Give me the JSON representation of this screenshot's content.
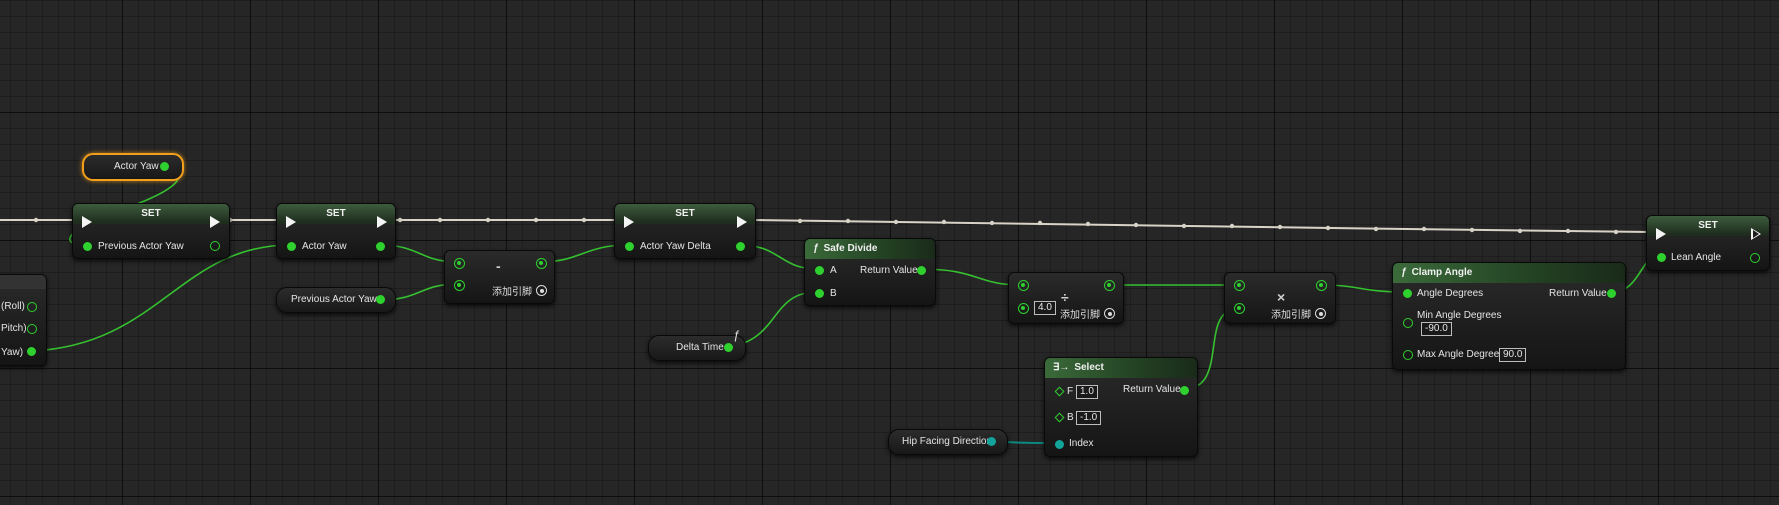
{
  "graph": {
    "add_pin_label": "添加引脚",
    "exec_wire_color": "#d8d3c6",
    "float_wire_color": "#35c030",
    "byte_wire_color": "#0b8a7f",
    "selection_color": "#f29f1b"
  },
  "actor_yaw_getter": {
    "label": "Actor Yaw"
  },
  "left_partial_node": {
    "pins": [
      "(Roll)",
      "Pitch)",
      "Yaw)"
    ]
  },
  "set_previous": {
    "title": "SET",
    "pin_label": "Previous Actor Yaw"
  },
  "set_actor_yaw": {
    "title": "SET",
    "pin_label": "Actor Yaw"
  },
  "previous_actor_yaw_getter": {
    "label": "Previous Actor Yaw"
  },
  "subtract_node": {
    "operator": "-"
  },
  "set_yaw_delta": {
    "title": "SET",
    "pin_label": "Actor Yaw Delta"
  },
  "delta_time_getter": {
    "label": "Delta Time"
  },
  "safe_divide": {
    "title": "Safe Divide",
    "pin_a": "A",
    "pin_b": "B",
    "return_label": "Return Value"
  },
  "divide_node": {
    "operator": "÷",
    "value": "4.0"
  },
  "multiply_node": {
    "operator": "×"
  },
  "select_node": {
    "title": "Select",
    "pin_f": "F",
    "value_f": "1.0",
    "pin_b": "B",
    "value_b": "-1.0",
    "pin_index": "Index",
    "return_label": "Return Value"
  },
  "hip_facing_getter": {
    "label": "Hip Facing Direction"
  },
  "clamp_angle": {
    "title": "Clamp Angle",
    "pin_angle": "Angle Degrees",
    "pin_min": "Min Angle Degrees",
    "value_min": "-90.0",
    "pin_max": "Max Angle Degrees",
    "value_max": "90.0",
    "return_label": "Return Value"
  },
  "set_lean": {
    "title": "SET",
    "pin_label": "Lean Angle"
  }
}
